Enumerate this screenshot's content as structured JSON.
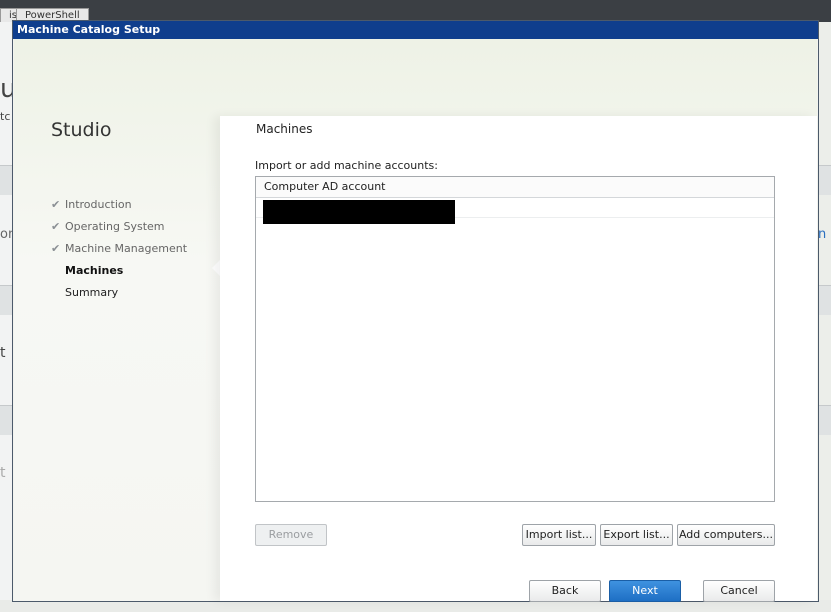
{
  "background": {
    "tab_label": "PowerShell",
    "left_tab_fragment": "is",
    "fragments": [
      "u|",
      "tc",
      "on",
      "t",
      "t"
    ],
    "right_fragment": "n"
  },
  "dialog": {
    "title": "Machine Catalog Setup",
    "brand": "Studio",
    "steps": [
      {
        "label": "Introduction",
        "completed": true
      },
      {
        "label": "Operating System",
        "completed": true
      },
      {
        "label": "Machine Management",
        "completed": true
      },
      {
        "label": "Machines",
        "current": true
      },
      {
        "label": "Summary"
      }
    ],
    "check_glyph": "✔",
    "main": {
      "section_title": "Machines",
      "instruction": "Import or add machine accounts:",
      "list": {
        "column_header": "Computer AD account",
        "rows": [
          {
            "value": "[redacted]"
          }
        ]
      },
      "buttons": {
        "remove": "Remove",
        "import": "Import list...",
        "export": "Export list...",
        "add": "Add computers..."
      }
    },
    "footer": {
      "back": "Back",
      "next": "Next",
      "cancel": "Cancel"
    }
  },
  "colors": {
    "titlebar": "#0f3e8d",
    "primary_button": "#1e6fc4"
  }
}
